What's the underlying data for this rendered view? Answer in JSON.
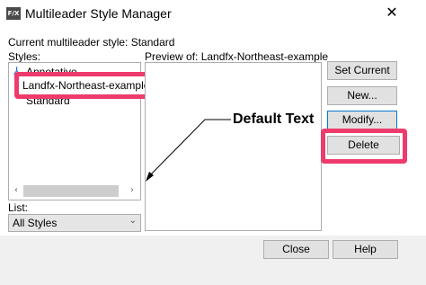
{
  "window": {
    "icon_text": "F/X",
    "title": "Multileader Style Manager",
    "close_glyph": "✕"
  },
  "current_style_label": "Current multileader style: Standard",
  "styles": {
    "label": "Styles:",
    "items": [
      {
        "label": "Annotative",
        "icon": "annotative-icon"
      },
      {
        "label": "Landfx-Northeast-example",
        "selected": true
      },
      {
        "label": "Standard"
      }
    ],
    "scroll_left": "‹",
    "scroll_right": "›"
  },
  "preview": {
    "label": "Preview of: Landfx-Northeast-example",
    "default_text": "Default Text"
  },
  "buttons": {
    "set_current": "Set Current",
    "new": "New...",
    "modify": "Modify...",
    "delete": "Delete",
    "close": "Close",
    "help": "Help"
  },
  "list": {
    "label": "List:",
    "selected": "All Styles",
    "chevron": "⌄"
  },
  "colors": {
    "highlight": "#ee3b6d",
    "focus": "#0078d7",
    "annotative_icon": "#1e6fd9"
  }
}
